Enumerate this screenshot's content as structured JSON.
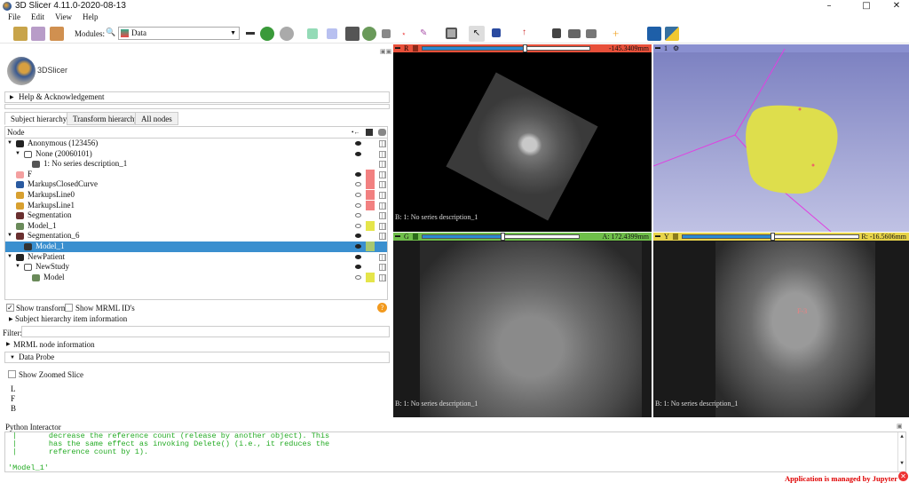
{
  "window": {
    "title": "3D Slicer 4.11.0-2020-08-13"
  },
  "menu": [
    "File",
    "Edit",
    "View",
    "Help"
  ],
  "toolbar": {
    "modules_label": "Modules:",
    "module_selected": "Data"
  },
  "logo_text": "3DSlicer",
  "sections": {
    "help": "Help & Acknowledgement",
    "subject_info": "Subject hierarchy item information",
    "mrml_info": "MRML node information",
    "data_probe": "Data Probe"
  },
  "tabs": [
    "Subject hierarchy",
    "Transform hierarchy",
    "All nodes"
  ],
  "tree": {
    "header": "Node",
    "rows": [
      {
        "label": "Anonymous (123456)",
        "indent": 0,
        "icon": "patient",
        "eye": "on",
        "color": null,
        "expanded": true
      },
      {
        "label": "None (20060101)",
        "indent": 1,
        "icon": "study",
        "eye": "on",
        "color": null,
        "expanded": true
      },
      {
        "label": "1: No series description_1",
        "indent": 2,
        "icon": "volume",
        "eye": "none",
        "color": null
      },
      {
        "label": "F",
        "indent": 0,
        "icon": "fiducial",
        "eye": "on",
        "color": "#f28080"
      },
      {
        "label": "MarkupsClosedCurve",
        "indent": 0,
        "icon": "closed-curve",
        "eye": "off",
        "color": "#f28080"
      },
      {
        "label": "MarkupsLine0",
        "indent": 0,
        "icon": "line",
        "eye": "off",
        "color": "#f28080"
      },
      {
        "label": "MarkupsLine1",
        "indent": 0,
        "icon": "line",
        "eye": "off",
        "color": "#f28080"
      },
      {
        "label": "Segmentation",
        "indent": 0,
        "icon": "segmentation",
        "eye": "off",
        "color": null
      },
      {
        "label": "Model_1",
        "indent": 0,
        "icon": "model",
        "eye": "off",
        "color": "#e5e54a"
      },
      {
        "label": "Segmentation_6",
        "indent": 0,
        "icon": "segmentation",
        "eye": "on",
        "color": null,
        "expanded": true
      },
      {
        "label": "Model_1",
        "indent": 1,
        "icon": "segment",
        "eye": "on",
        "color": "#a8c870",
        "selected": true
      },
      {
        "label": "NewPatient",
        "indent": 0,
        "icon": "patient",
        "eye": "on",
        "color": null,
        "expanded": true
      },
      {
        "label": "NewStudy",
        "indent": 1,
        "icon": "study",
        "eye": "on",
        "color": null,
        "expanded": true
      },
      {
        "label": "Model",
        "indent": 2,
        "icon": "model",
        "eye": "off",
        "color": "#e5e54a"
      }
    ]
  },
  "options": {
    "show_transforms": "Show transforms",
    "show_transforms_checked": true,
    "show_mrml_ids": "Show MRML ID's",
    "show_mrml_ids_checked": false
  },
  "filter_label": "Filter:",
  "data_probe": {
    "show_zoomed": "Show Zoomed Slice",
    "lines": [
      "L",
      "F",
      "B"
    ]
  },
  "views": {
    "red": {
      "letter": "R",
      "offset": "-145.3409mm",
      "color": "#e8503a",
      "bottom": "B: 1: No series description_1",
      "slider": 0.6
    },
    "threed": {
      "letter": "1",
      "color": "#7a7fc0"
    },
    "green": {
      "letter": "G",
      "offset": "A: 172.4399mm",
      "color": "#6fbf4a",
      "bottom": "B: 1: No series description_1",
      "slider": 0.5
    },
    "yellow": {
      "letter": "Y",
      "offset": "R: -16.5606mm",
      "color": "#e8d44a",
      "bottom": "B: 1: No series description_1",
      "slider": 0.5
    },
    "marker_label": "F-3"
  },
  "python": {
    "title": "Python Interactor",
    "lines": [
      " |       decrease the reference count (release by another object). This",
      " |       has the same effect as invoking Delete() (i.e., it reduces the",
      " |       reference count by 1).",
      "",
      "'Model_1'"
    ]
  },
  "status": {
    "message": "Application is managed by Jupyter"
  }
}
